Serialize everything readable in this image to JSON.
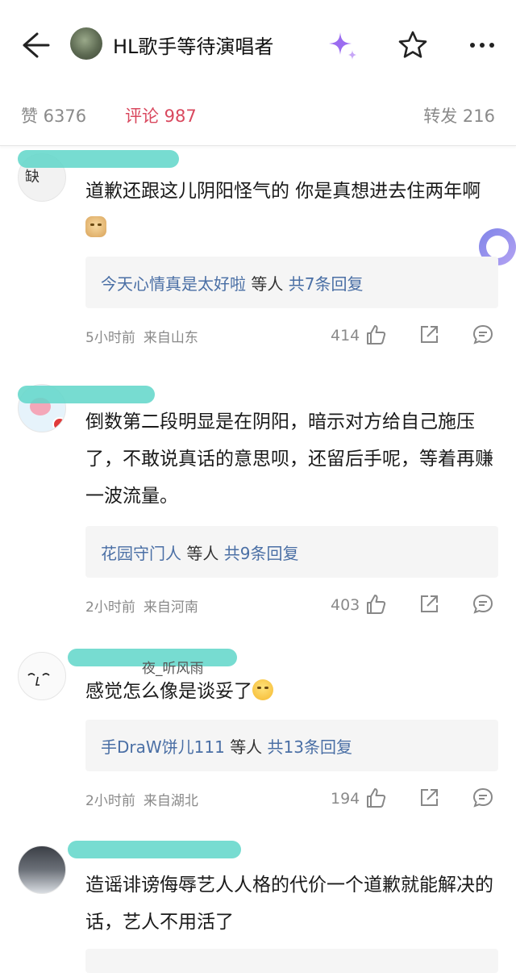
{
  "header": {
    "title": "HL歌手等待演唱者",
    "back_icon": "arrow-left-icon",
    "sparkle_icon": "sparkle-icon",
    "star_icon": "star-icon",
    "more_icon": "more-dots-icon",
    "sparkle_color": "#9b6cf0"
  },
  "tabs": {
    "like": "赞 6376",
    "comment": "评论 987",
    "repost": "转发 216",
    "active_color": "#d9485e"
  },
  "comments": [
    {
      "avatar_text": "缺",
      "text": "道歉还跟这儿阴阳怪气的 你是真想进去住两年啊",
      "emoji": "doge",
      "reply_user": "今天心情真是太好啦",
      "reply_mid": "等人",
      "reply_count": "共7条回复",
      "time": "5小时前",
      "location": "来自山东",
      "likes": "414"
    },
    {
      "text": "倒数第二段明显是在阴阳，暗示对方给自己施压了，不敢说真话的意思呗，还留后手呢，等着再赚一波流量。",
      "reply_user": "花园守门人",
      "reply_mid": "等人",
      "reply_count": "共9条回复",
      "time": "2小时前",
      "location": "来自河南",
      "likes": "403"
    },
    {
      "name_visible": "夜_听风雨",
      "text": "感觉怎么像是谈妥了",
      "emoji": "smile",
      "reply_user": "手DraW饼儿111",
      "reply_mid": "等人",
      "reply_count": "共13条回复",
      "time": "2小时前",
      "location": "来自湖北",
      "likes": "194"
    },
    {
      "text": "造谣诽谤侮辱艺人人格的代价一个道歉就能解决的话，艺人不用活了"
    }
  ],
  "icons": {
    "like": "thumbs-up-icon",
    "share": "share-icon",
    "comment": "comment-icon"
  }
}
